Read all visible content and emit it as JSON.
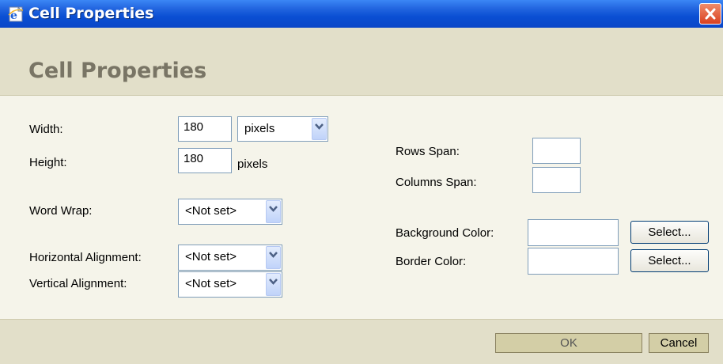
{
  "window": {
    "title": "Cell Properties"
  },
  "header": {
    "title": "Cell Properties"
  },
  "form": {
    "width_label": "Width:",
    "width_value": "180",
    "width_unit": "pixels",
    "height_label": "Height:",
    "height_value": "180",
    "height_unit": "pixels",
    "word_wrap_label": "Word Wrap:",
    "word_wrap_value": "<Not set>",
    "halign_label": "Horizontal Alignment:",
    "halign_value": "<Not set>",
    "valign_label": "Vertical Alignment:",
    "valign_value": "<Not set>",
    "rows_span_label": "Rows Span:",
    "rows_span_value": "",
    "cols_span_label": "Columns Span:",
    "cols_span_value": "",
    "bg_color_label": "Background Color:",
    "bg_color_value": "",
    "bg_select_label": "Select...",
    "border_color_label": "Border Color:",
    "border_color_value": "",
    "border_select_label": "Select..."
  },
  "footer": {
    "ok_label": "OK",
    "cancel_label": "Cancel"
  },
  "icons": {
    "title": "ie-document-icon",
    "close": "close-icon",
    "dropdown": "chevron-down-icon"
  },
  "colors": {
    "titlebar": "#0a4fd3",
    "header_band": "#e2dfc9",
    "content_bg": "#f5f4ea",
    "close_button": "#d9401f"
  }
}
